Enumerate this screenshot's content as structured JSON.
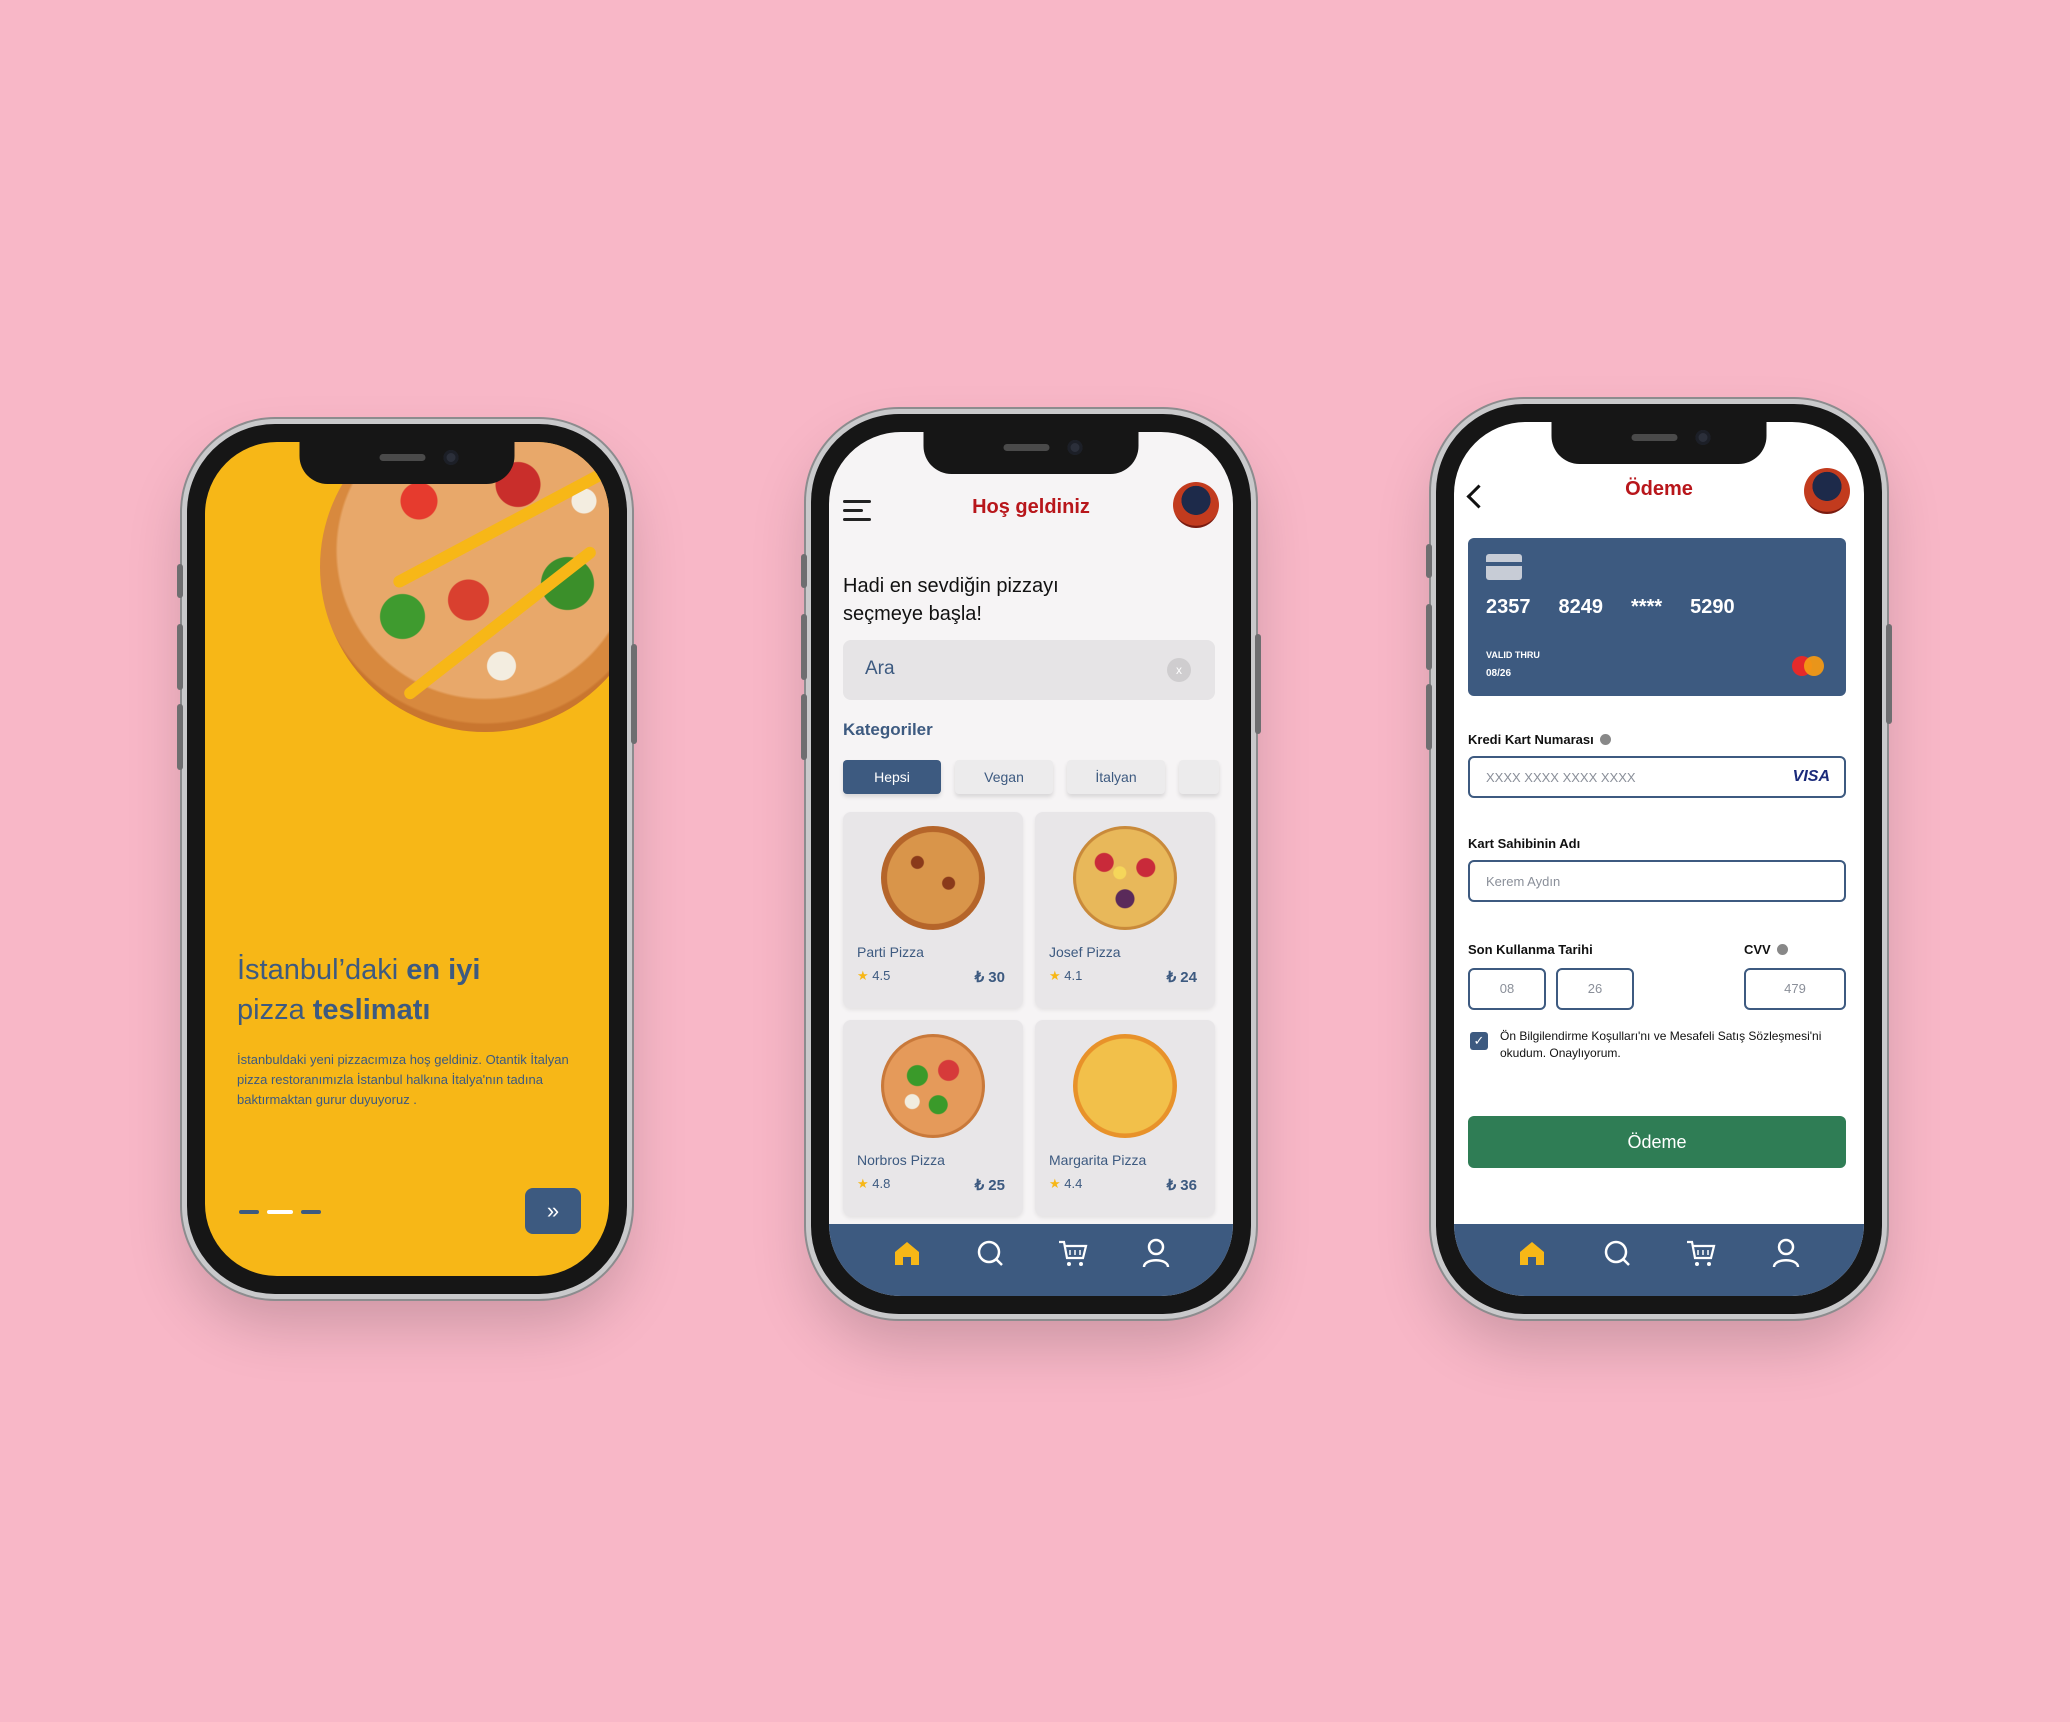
{
  "onboarding": {
    "title_part1": "İstanbul’daki ",
    "title_bold1": "en iyi",
    "title_part2": "pizza ",
    "title_bold2": "teslimatı",
    "description": "İstanbuldaki yeni pizzacımıza hoş geldiniz. Otantik İtalyan pizza restoranımızla İstanbul halkına İtalya'nın tadına baktırmaktan gurur duyuyoruz .",
    "next_label": "»",
    "page_indicator": {
      "total": 3,
      "active": 2
    }
  },
  "home": {
    "header_title": "Hoş geldiniz",
    "greeting": "Hadi en sevdiğin pizzayı seçmeye başla!",
    "search_placeholder": "Ara",
    "search_clear": "x",
    "categories_title": "Kategoriler",
    "categories": [
      "Hepsi",
      "Vegan",
      "İtalyan"
    ],
    "products": [
      {
        "name": "Parti Pizza",
        "rating": "4.5",
        "price": "₺ 30"
      },
      {
        "name": "Josef Pizza",
        "rating": "4.1",
        "price": "₺ 24"
      },
      {
        "name": "Norbros Pizza",
        "rating": "4.8",
        "price": "₺ 25"
      },
      {
        "name": "Margarita Pizza",
        "rating": "4.4",
        "price": "₺ 36"
      }
    ],
    "star": "★"
  },
  "payment": {
    "header_title": "Ödeme",
    "card": {
      "g1": "2357",
      "g2": "8249",
      "g3": "****",
      "g4": "5290",
      "valid_label": "VALID THRU",
      "valid_date": "08/26"
    },
    "card_number_label": "Kredi Kart Numarası",
    "card_number_placeholder": "XXXX XXXX XXXX XXXX",
    "visa": "VISA",
    "holder_label": "Kart Sahibinin Adı",
    "holder_placeholder": "Kerem Aydın",
    "expiry_label": "Son Kullanma Tarihi",
    "expiry_month": "08",
    "expiry_year": "26",
    "cvv_label": "CVV",
    "cvv_value": "479",
    "terms_checkbox": "✓",
    "terms": "Ön Bilgilendirme Koşulları'nı ve Mesafeli Satış Sözleşmesi'ni okudum. Onaylıyorum.",
    "pay_button": "Ödeme"
  },
  "nav_icons": [
    "home-icon",
    "search-icon",
    "cart-icon",
    "profile-icon"
  ],
  "colors": {
    "background": "#f8b7c7",
    "primary": "#3d5a80",
    "yellow": "#f7b717",
    "red_title": "#b8161b",
    "pay_green": "#2f7d55"
  }
}
